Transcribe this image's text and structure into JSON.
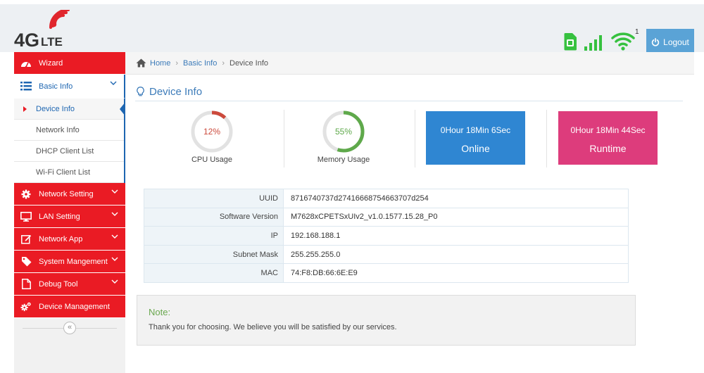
{
  "colors": {
    "brand_red": "#ea1b24",
    "accent_blue": "#1e66b1",
    "online_blue": "#2f86d2",
    "runtime_pink": "#dd3c7c",
    "signal_green": "#36c13f"
  },
  "header": {
    "logo_text": "4G",
    "logo_sub": "LTE",
    "wifi_clients": "1",
    "logout_label": "Logout",
    "icons": [
      "sim-card-icon",
      "signal-bars-icon",
      "wifi-icon",
      "power-icon"
    ]
  },
  "sidebar": {
    "wizard": "Wizard",
    "basic_info": "Basic Info",
    "basic_info_sub": [
      "Device Info",
      "Network Info",
      "DHCP Client List",
      "Wi-Fi Client List"
    ],
    "network_setting": "Network Setting",
    "lan_setting": "LAN Setting",
    "network_app": "Network App",
    "system_management": "System Mangement",
    "debug_tool": "Debug Tool",
    "device_management": "Device Management",
    "collapse_glyph": "«"
  },
  "breadcrumb": {
    "home": "Home",
    "section": "Basic Info",
    "current": "Device Info",
    "sep": "›"
  },
  "page": {
    "title": "Device Info"
  },
  "stats": {
    "cpu": {
      "value_text": "12%",
      "value": 0.12,
      "label": "CPU Usage",
      "color": "#cc4a3c"
    },
    "memory": {
      "value_text": "55%",
      "value": 0.55,
      "label": "Memory Usage",
      "color": "#5fa94b"
    },
    "online": {
      "time": "0Hour 18Min 6Sec",
      "label": "Online"
    },
    "runtime": {
      "time": "0Hour 18Min 44Sec",
      "label": "Runtime"
    }
  },
  "device_info": [
    {
      "key": "UUID",
      "value": "8716740737d27416668754663707d254"
    },
    {
      "key": "Software Version",
      "value": "M7628xCPETSxUIv2_v1.0.1577.15.28_P0"
    },
    {
      "key": "IP",
      "value": "192.168.188.1"
    },
    {
      "key": "Subnet Mask",
      "value": "255.255.255.0"
    },
    {
      "key": "MAC",
      "value": "74:F8:DB:66:6E:E9"
    }
  ],
  "note": {
    "title": "Note:",
    "text": "Thank you for choosing. We believe you will be satisfied by our services."
  }
}
